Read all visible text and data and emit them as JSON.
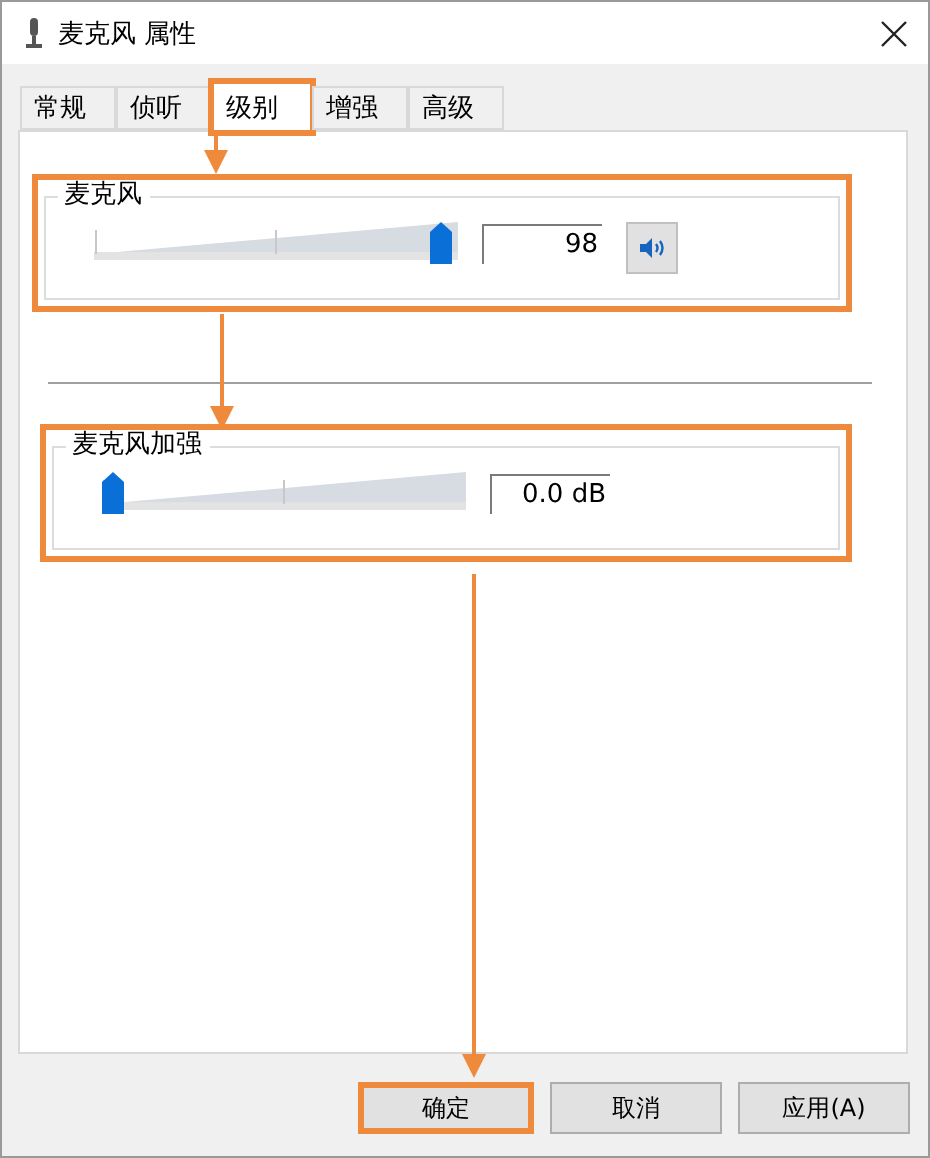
{
  "window": {
    "title": "麦克风 属性"
  },
  "tabs": [
    {
      "label": "常规",
      "selected": false,
      "highlighted": false
    },
    {
      "label": "侦听",
      "selected": false,
      "highlighted": false
    },
    {
      "label": "级别",
      "selected": true,
      "highlighted": true
    },
    {
      "label": "增强",
      "selected": false,
      "highlighted": false
    },
    {
      "label": "高级",
      "selected": false,
      "highlighted": false
    }
  ],
  "groups": [
    {
      "title": "麦克风",
      "level": 0.98,
      "value": "98",
      "highlighted": true,
      "mute_button": true
    },
    {
      "title": "麦克风加强",
      "level": 0,
      "value": "0.0 dB",
      "highlighted": true,
      "mute_button": false
    }
  ],
  "buttons": [
    {
      "label": "确定",
      "highlighted": true
    },
    {
      "label": "取消",
      "highlighted": false
    },
    {
      "label": "应用(A)",
      "highlighted": false
    }
  ],
  "callout_arrows": true
}
